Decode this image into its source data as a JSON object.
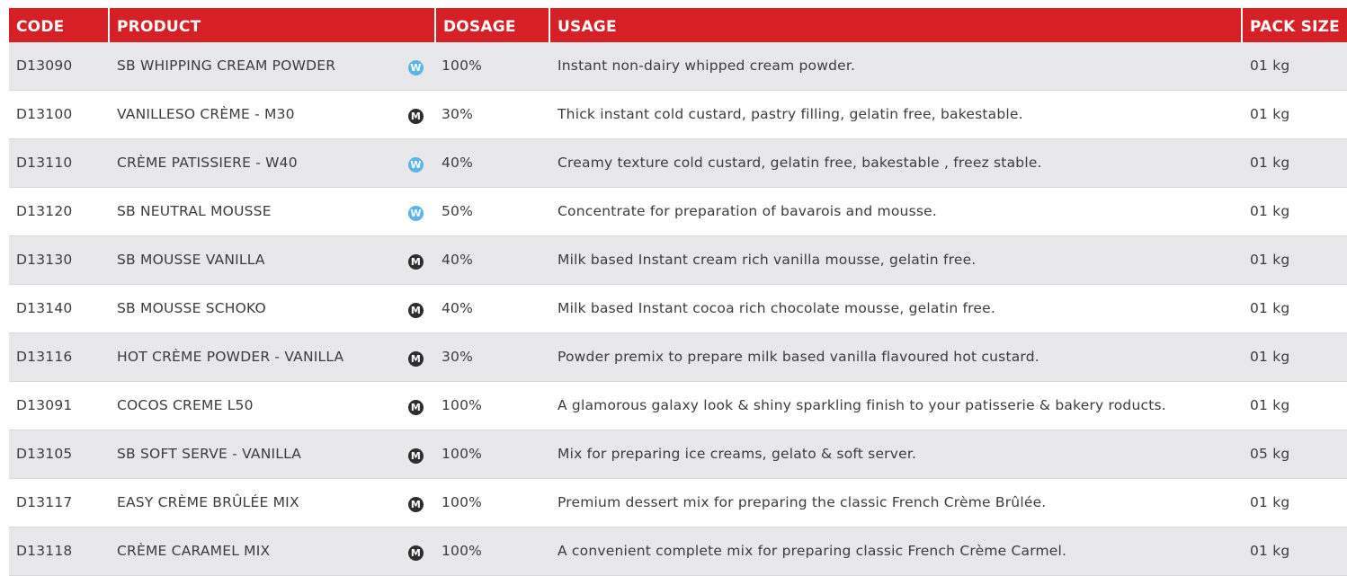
{
  "header": {
    "code": "CODE",
    "product": "PRODUCT",
    "dosage": "DOSAGE",
    "usage": "USAGE",
    "pack_size": "PACK SIZE"
  },
  "colors": {
    "header_bg": "#d71f26",
    "row_alt_bg": "#e8e8eb",
    "badge_w": "#5ab6e8",
    "badge_m": "#2e2e2e"
  },
  "rows": [
    {
      "code": "D13090",
      "product": "SB WHIPPING CREAM POWDER",
      "badge": "W",
      "dosage": "100%",
      "usage": "Instant non-dairy whipped cream powder.",
      "pack": "01 kg"
    },
    {
      "code": "D13100",
      "product": "VANILLESO CRÈME - M30",
      "badge": "M",
      "dosage": "30%",
      "usage": "Thick instant cold custard, pastry filling, gelatin free, bakestable.",
      "pack": "01 kg"
    },
    {
      "code": "D13110",
      "product": "CRÈME PATISSIERE - W40",
      "badge": "W",
      "dosage": "40%",
      "usage": "Creamy texture cold custard, gelatin free, bakestable , freez stable.",
      "pack": "01 kg"
    },
    {
      "code": "D13120",
      "product": "SB NEUTRAL MOUSSE",
      "badge": "W",
      "dosage": "50%",
      "usage": "Concentrate for preparation of bavarois and mousse.",
      "pack": "01 kg"
    },
    {
      "code": "D13130",
      "product": "SB MOUSSE VANILLA",
      "badge": "M",
      "dosage": "40%",
      "usage": "Milk based Instant cream rich vanilla mousse, gelatin free.",
      "pack": "01 kg"
    },
    {
      "code": "D13140",
      "product": "SB MOUSSE SCHOKO",
      "badge": "M",
      "dosage": "40%",
      "usage": "Milk based Instant cocoa rich chocolate mousse, gelatin free.",
      "pack": "01 kg"
    },
    {
      "code": "D13116",
      "product": "HOT CRÈME POWDER - VANILLA",
      "badge": "M",
      "dosage": "30%",
      "usage": "Powder premix to prepare milk based vanilla flavoured hot custard.",
      "pack": "01 kg"
    },
    {
      "code": "D13091",
      "product": "COCOS CREME L50",
      "badge": "M",
      "dosage": "100%",
      "usage": "A glamorous galaxy look & shiny sparkling finish to your patisserie & bakery roducts.",
      "pack": "01 kg"
    },
    {
      "code": "D13105",
      "product": "SB SOFT SERVE - VANILLA",
      "badge": "M",
      "dosage": "100%",
      "usage": "Mix for preparing ice creams, gelato & soft server.",
      "pack": "05 kg"
    },
    {
      "code": "D13117",
      "product": "EASY CRÈME BRÛLÉE MIX",
      "badge": "M",
      "dosage": "100%",
      "usage": "Premium dessert mix for preparing the classic French Crème Brûlée.",
      "pack": "01 kg"
    },
    {
      "code": "D13118",
      "product": "CRÈME CARAMEL MIX",
      "badge": "M",
      "dosage": "100%",
      "usage": "A convenient complete mix for preparing classic French Crème Carmel.",
      "pack": "01 kg"
    }
  ]
}
